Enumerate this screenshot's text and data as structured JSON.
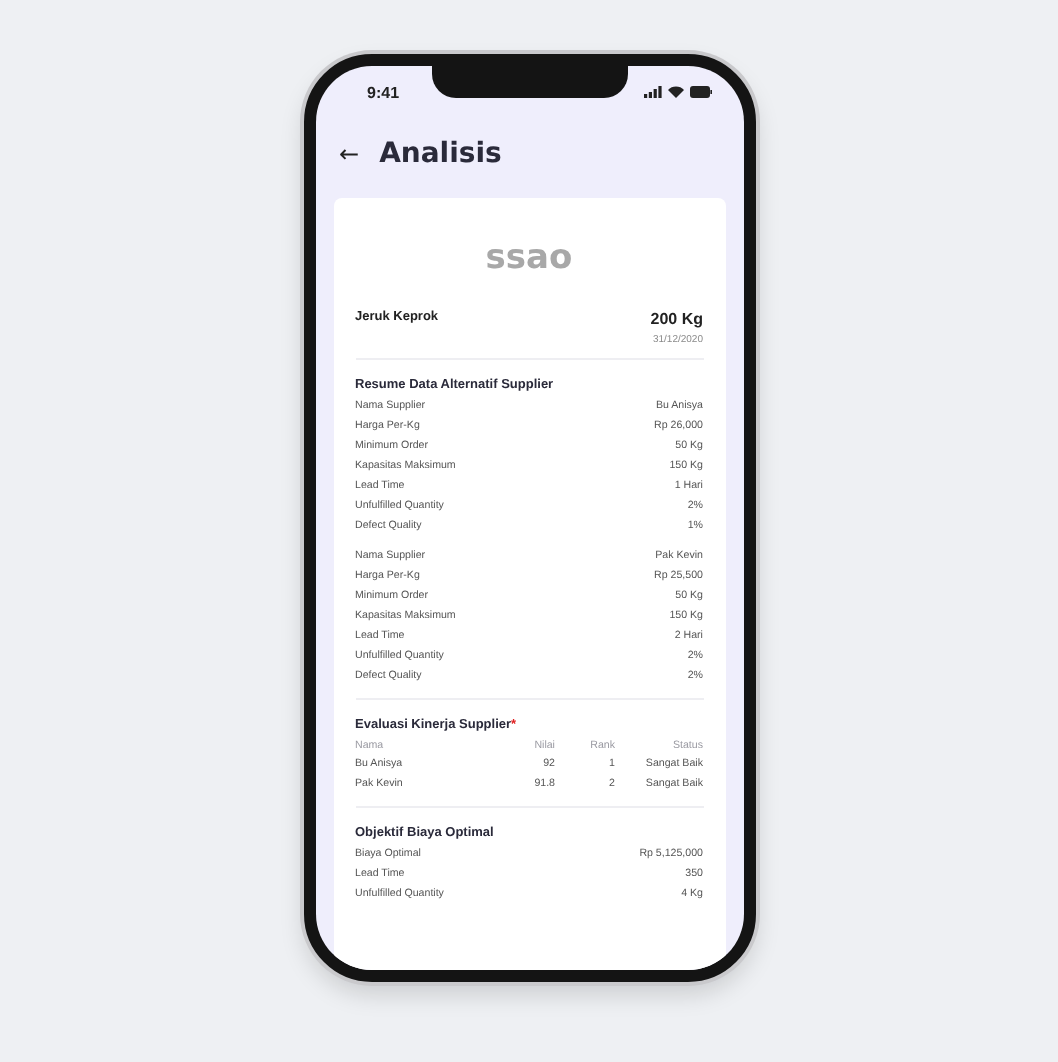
{
  "status_bar": {
    "time": "9:41"
  },
  "header": {
    "back": "←",
    "title": "Analisis"
  },
  "card": {
    "logo": "ssao",
    "product": {
      "name": "Jeruk Keprok",
      "quantity": "200 Kg",
      "date": "31/12/2020"
    },
    "resume": {
      "title": "Resume Data Alternatif Supplier",
      "groups": [
        [
          {
            "label": "Nama Supplier",
            "value": "Bu Anisya"
          },
          {
            "label": "Harga Per-Kg",
            "value": "Rp 26,000"
          },
          {
            "label": "Minimum Order",
            "value": "50 Kg"
          },
          {
            "label": "Kapasitas Maksimum",
            "value": "150 Kg"
          },
          {
            "label": "Lead Time",
            "value": "1 Hari"
          },
          {
            "label": "Unfulfilled Quantity",
            "value": "2%"
          },
          {
            "label": "Defect Quality",
            "value": "1%"
          }
        ],
        [
          {
            "label": "Nama Supplier",
            "value": "Pak Kevin"
          },
          {
            "label": "Harga Per-Kg",
            "value": "Rp 25,500"
          },
          {
            "label": "Minimum Order",
            "value": "50 Kg"
          },
          {
            "label": "Kapasitas Maksimum",
            "value": "150 Kg"
          },
          {
            "label": "Lead Time",
            "value": "2 Hari"
          },
          {
            "label": "Unfulfilled Quantity",
            "value": "2%"
          },
          {
            "label": "Defect Quality",
            "value": "2%"
          }
        ]
      ]
    },
    "evaluation": {
      "title": "Evaluasi Kinerja Supplier",
      "required_mark": "*",
      "columns": [
        "Nama",
        "Nilai",
        "Rank",
        "Status"
      ],
      "rows": [
        [
          "Bu Anisya",
          "92",
          "1",
          "Sangat Baik"
        ],
        [
          "Pak Kevin",
          "91.8",
          "2",
          "Sangat Baik"
        ]
      ]
    },
    "objective": {
      "title": "Objektif Biaya Optimal",
      "rows": [
        {
          "label": "Biaya Optimal",
          "value": "Rp 5,125,000"
        },
        {
          "label": "Lead Time",
          "value": "350"
        },
        {
          "label": "Unfulfilled Quantity",
          "value": "4 Kg"
        }
      ]
    }
  }
}
